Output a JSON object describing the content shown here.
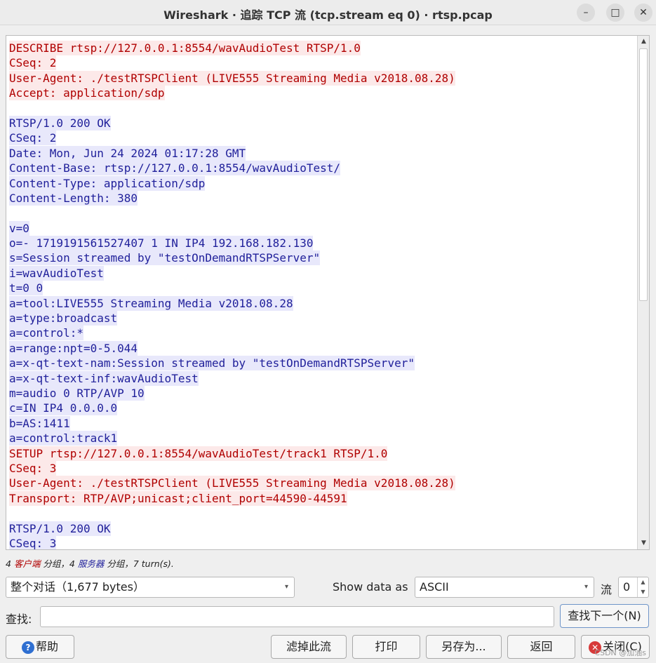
{
  "window": {
    "title": "Wireshark · 追踪 TCP 流 (tcp.stream eq 0) · rtsp.pcap",
    "min_glyph": "–",
    "max_glyph": "□",
    "close_glyph": "✕"
  },
  "stream": {
    "lines": [
      {
        "who": "client",
        "text": "DESCRIBE rtsp://127.0.0.1:8554/wavAudioTest RTSP/1.0"
      },
      {
        "who": "client",
        "text": "CSeq: 2"
      },
      {
        "who": "client",
        "text": "User-Agent: ./testRTSPClient (LIVE555 Streaming Media v2018.08.28)"
      },
      {
        "who": "client",
        "text": "Accept: application/sdp"
      },
      {
        "who": "blank",
        "text": ""
      },
      {
        "who": "server",
        "text": "RTSP/1.0 200 OK"
      },
      {
        "who": "server",
        "text": "CSeq: 2"
      },
      {
        "who": "server",
        "text": "Date: Mon, Jun 24 2024 01:17:28 GMT"
      },
      {
        "who": "server",
        "text": "Content-Base: rtsp://127.0.0.1:8554/wavAudioTest/"
      },
      {
        "who": "server",
        "text": "Content-Type: application/sdp"
      },
      {
        "who": "server",
        "text": "Content-Length: 380"
      },
      {
        "who": "blank",
        "text": ""
      },
      {
        "who": "server",
        "text": "v=0"
      },
      {
        "who": "server",
        "text": "o=- 1719191561527407 1 IN IP4 192.168.182.130"
      },
      {
        "who": "server",
        "text": "s=Session streamed by \"testOnDemandRTSPServer\""
      },
      {
        "who": "server",
        "text": "i=wavAudioTest"
      },
      {
        "who": "server",
        "text": "t=0 0"
      },
      {
        "who": "server",
        "text": "a=tool:LIVE555 Streaming Media v2018.08.28"
      },
      {
        "who": "server",
        "text": "a=type:broadcast"
      },
      {
        "who": "server",
        "text": "a=control:*"
      },
      {
        "who": "server",
        "text": "a=range:npt=0-5.044"
      },
      {
        "who": "server",
        "text": "a=x-qt-text-nam:Session streamed by \"testOnDemandRTSPServer\""
      },
      {
        "who": "server",
        "text": "a=x-qt-text-inf:wavAudioTest"
      },
      {
        "who": "server",
        "text": "m=audio 0 RTP/AVP 10"
      },
      {
        "who": "server",
        "text": "c=IN IP4 0.0.0.0"
      },
      {
        "who": "server",
        "text": "b=AS:1411"
      },
      {
        "who": "server",
        "text": "a=control:track1"
      },
      {
        "who": "client",
        "text": "SETUP rtsp://127.0.0.1:8554/wavAudioTest/track1 RTSP/1.0"
      },
      {
        "who": "client",
        "text": "CSeq: 3"
      },
      {
        "who": "client",
        "text": "User-Agent: ./testRTSPClient (LIVE555 Streaming Media v2018.08.28)"
      },
      {
        "who": "client",
        "text": "Transport: RTP/AVP;unicast;client_port=44590-44591"
      },
      {
        "who": "blank",
        "text": ""
      },
      {
        "who": "server",
        "text": "RTSP/1.0 200 OK"
      },
      {
        "who": "server",
        "text": "CSeq: 3"
      }
    ],
    "scroll_up": "▲",
    "scroll_down": "▼"
  },
  "status": {
    "client_count": "4 ",
    "client_word": "客户端",
    "mid": " 分组，4 ",
    "server_word": "服务器",
    "tail": " 分组，7 turn(s)."
  },
  "controls": {
    "conversation_value": "整个对话（1,677 bytes）",
    "show_data_as_label": "Show data as",
    "show_data_as_value": "ASCII",
    "stream_label": "流",
    "stream_value": "0",
    "caret": "▾"
  },
  "find": {
    "label": "查找:",
    "value": "",
    "find_next_label": "查找下一个(N)"
  },
  "buttons": {
    "help": "帮助",
    "filter_out": "滤掉此流",
    "print": "打印",
    "save_as": "另存为...",
    "back": "返回",
    "close": "关闭(C)"
  },
  "colors": {
    "client_text": "#b00000",
    "client_bg": "#fce9e9",
    "server_text": "#1f1f9a",
    "server_bg": "#e8e8fb"
  },
  "watermark": "CSDN @加油s"
}
